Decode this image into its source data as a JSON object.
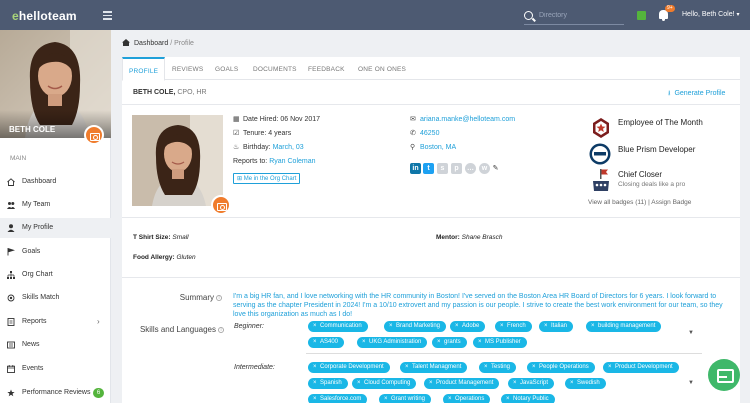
{
  "header": {
    "logo_prefix": "e",
    "logo_text": "helloteam",
    "search_placeholder": "Directory",
    "notification_count": "9+",
    "greeting": "Hello, Beth Cole!"
  },
  "sidebar": {
    "user_name": "BETH COLE",
    "section_label": "MAIN",
    "items": [
      {
        "label": "Dashboard",
        "icon": "home-icon"
      },
      {
        "label": "My Team",
        "icon": "team-icon"
      },
      {
        "label": "My Profile",
        "icon": "user-icon",
        "active": true
      },
      {
        "label": "Goals",
        "icon": "goals-icon"
      },
      {
        "label": "Org Chart",
        "icon": "org-chart-icon"
      },
      {
        "label": "Skills Match",
        "icon": "skills-icon"
      },
      {
        "label": "Reports",
        "icon": "reports-icon",
        "chevron": "›"
      },
      {
        "label": "News",
        "icon": "news-icon"
      },
      {
        "label": "Events",
        "icon": "calendar-icon"
      },
      {
        "label": "Performance Reviews",
        "icon": "reviews-icon",
        "badge": "6"
      }
    ]
  },
  "breadcrumb": {
    "home": "Dashboard",
    "separator": "/",
    "current": "Profile"
  },
  "tabs": [
    "PROFILE",
    "REVIEWS",
    "GOALS",
    "DOCUMENTS",
    "FEEDBACK",
    "ONE ON ONES"
  ],
  "profile": {
    "name": "BETH COLE",
    "title": "CPO, HR",
    "generate_label": "Generate Profile",
    "date_hired": "Date Hired: 06 Nov 2017",
    "tenure": "Tenure: 4 years",
    "birthday_label": "Birthday:",
    "birthday": "March, 03",
    "reports_to_label": "Reports to:",
    "reports_to": "Ryan Coleman",
    "org_chart_button": "Me in the Org Chart",
    "email": "ariana.manke@helloteam.com",
    "phone": "46250",
    "location": "Boston, MA",
    "tshirt_label": "T Shirt Size:",
    "tshirt": "Small",
    "mentor_label": "Mentor:",
    "mentor": "Shane Brasch",
    "allergy_label": "Food Allergy:",
    "allergy": "Gluten"
  },
  "badges": {
    "items": [
      {
        "title": "Employee of The Month",
        "subtitle": ""
      },
      {
        "title": "Blue Prism Developer",
        "subtitle": ""
      },
      {
        "title": "Chief Closer",
        "subtitle": "Closing deals like a pro"
      }
    ],
    "view_all": "View all badges (11)",
    "separator": "|",
    "assign": "Assign Badge"
  },
  "summary": {
    "label": "Summary",
    "text": "I'm a big HR fan, and I love networking with the HR community in Boston! I've served on the Boston Area HR Board of Directors for 6 years. I look forward to serving as the chapter President in 2024! I'm a 10/10 extrovert and my passion is our people. I strive to create the best work environment for our team, so they love this organization as much as I do!"
  },
  "skills": {
    "label": "Skills and Languages",
    "beginner_label": "Beginner:",
    "beginner": [
      "Communication",
      "Brand Marketing",
      "Adobe",
      "French",
      "Italian",
      "building management",
      "AS400",
      "UKG Administration",
      "grants",
      "MS Publisher"
    ],
    "intermediate_label": "Intermediate:",
    "intermediate": [
      "Corporate Development",
      "Talent Managment",
      "Testing",
      "People Operations",
      "Product Development",
      "Spanish",
      "Cloud Computing",
      "Product Management",
      "JavaScript",
      "Swedish",
      "Salesforce.com",
      "Grant writing",
      "Operations",
      "Notary Public"
    ]
  }
}
